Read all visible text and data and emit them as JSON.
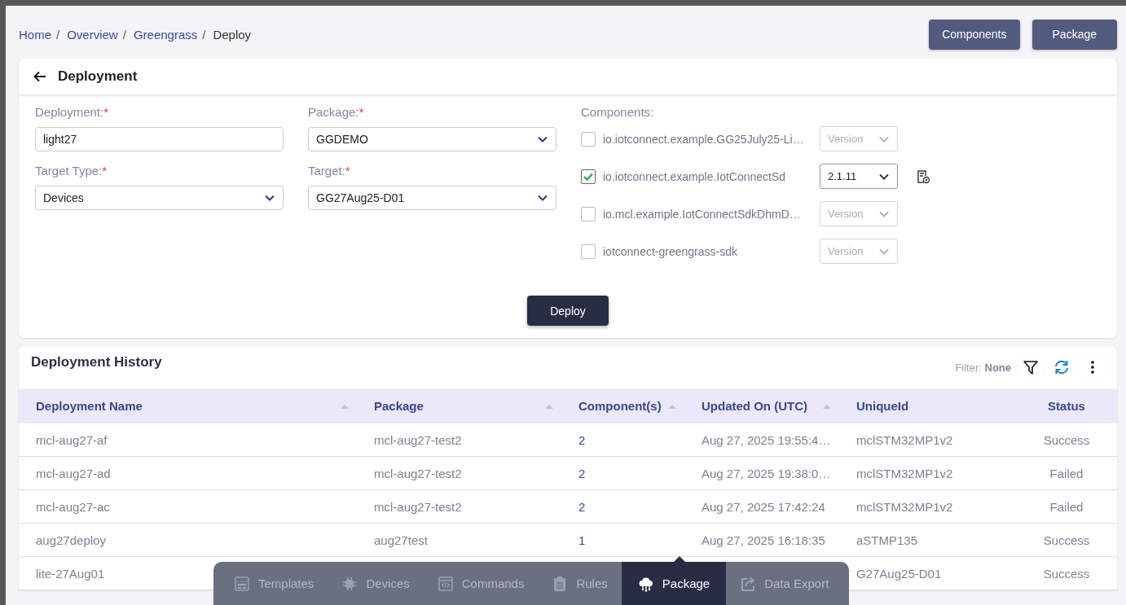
{
  "breadcrumb": [
    {
      "label": "Home",
      "kind": "link",
      "separator": "/"
    },
    {
      "label": "Overview",
      "kind": "link",
      "separator": "/"
    },
    {
      "label": "Greengrass",
      "kind": "link",
      "separator": "/"
    },
    {
      "label": "Deploy",
      "kind": "current"
    }
  ],
  "header_buttons": [
    "Components",
    "Package"
  ],
  "deployment_form": {
    "title": "Deployment",
    "fields": [
      {
        "label": "Deployment:",
        "required_mark": "*",
        "kind": "text",
        "value": "light27"
      },
      {
        "label": "Package:",
        "required_mark": "*",
        "kind": "select",
        "value": "GGDEMO"
      },
      {
        "label": "Target Type:",
        "required_mark": "*",
        "kind": "select",
        "value": "Devices"
      },
      {
        "label": "Target:",
        "required_mark": "*",
        "kind": "select",
        "value": "GG27Aug25-D01"
      }
    ],
    "components_label": "Components:",
    "components": [
      {
        "name": "io.iotconnect.example.GG25July25-Li…",
        "checked": false,
        "version_placeholder": "Version"
      },
      {
        "name": "io.iotconnect.example.IotConnectSd",
        "checked": true,
        "version": "2.1.11"
      },
      {
        "name": "io.mcl.example.IotConnectSdkDhmD…",
        "checked": false,
        "version_placeholder": "Version"
      },
      {
        "name": "iotconnect-greengrass-sdk",
        "checked": false,
        "version_placeholder": "Version"
      }
    ],
    "deploy_button": "Deploy"
  },
  "deployment_history": {
    "title": "Deployment History",
    "filter_label": "Filter:",
    "filter_value": "None",
    "columns": [
      {
        "label": "Deployment Name",
        "sortable": true
      },
      {
        "label": "Package",
        "sortable": true
      },
      {
        "label": "Component(s)",
        "sortable": true
      },
      {
        "label": "Updated On (UTC)",
        "sortable": true
      },
      {
        "label": "UniqueId",
        "sortable": false
      },
      {
        "label": "Status",
        "sortable": false
      }
    ],
    "rows": [
      {
        "deployment_name": "mcl-aug27-af",
        "package": "mcl-aug27-test2",
        "components": "2",
        "updated_on": "Aug 27, 2025 19:55:4…",
        "unique_id": "mclSTM32MP1v2",
        "status": "Success"
      },
      {
        "deployment_name": "mcl-aug27-ad",
        "package": "mcl-aug27-test2",
        "components": "2",
        "updated_on": "Aug 27, 2025 19:38:0…",
        "unique_id": "mclSTM32MP1v2",
        "status": "Failed"
      },
      {
        "deployment_name": "mcl-aug27-ac",
        "package": "mcl-aug27-test2",
        "components": "2",
        "updated_on": "Aug 27, 2025 17:42:24",
        "unique_id": "mclSTM32MP1v2",
        "status": "Failed"
      },
      {
        "deployment_name": "aug27deploy",
        "package": "aug27test",
        "components": "1",
        "updated_on": "Aug 27, 2025 16:18:35",
        "unique_id": "aSTMP135",
        "status": "Success"
      },
      {
        "deployment_name": "lite-27Aug01",
        "unique_id": "G27Aug25-D01",
        "status": "Success"
      }
    ]
  },
  "bottom_nav": [
    {
      "label": "Templates",
      "selected": false
    },
    {
      "label": "Devices",
      "selected": false
    },
    {
      "label": "Commands",
      "selected": false
    },
    {
      "label": "Rules",
      "selected": false
    },
    {
      "label": "Package",
      "selected": true
    },
    {
      "label": "Data Export",
      "selected": false
    }
  ]
}
